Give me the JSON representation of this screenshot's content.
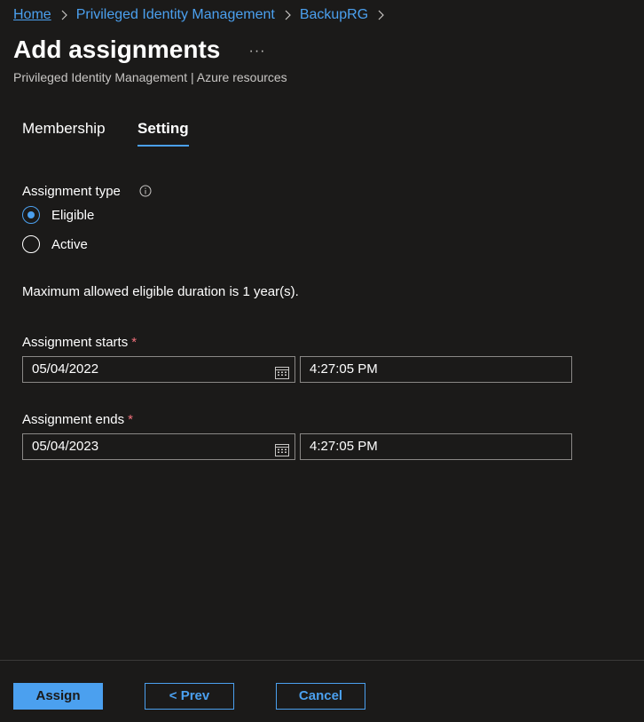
{
  "breadcrumb": {
    "items": [
      "Home",
      "Privileged Identity Management",
      "BackupRG"
    ]
  },
  "header": {
    "title": "Add assignments",
    "more": "···",
    "subtitle": "Privileged Identity Management | Azure resources"
  },
  "tabs": [
    {
      "label": "Membership",
      "selected": false
    },
    {
      "label": "Setting",
      "selected": true
    }
  ],
  "assignment_type": {
    "label": "Assignment type",
    "options": [
      {
        "label": "Eligible",
        "selected": true
      },
      {
        "label": "Active",
        "selected": false
      }
    ]
  },
  "duration_note": "Maximum allowed eligible duration is 1 year(s).",
  "starts": {
    "label": "Assignment starts",
    "required_mark": "*",
    "date": "05/04/2022",
    "time": "4:27:05 PM"
  },
  "ends": {
    "label": "Assignment ends",
    "required_mark": "*",
    "date": "05/04/2023",
    "time": "4:27:05 PM"
  },
  "footer": {
    "assign": "Assign",
    "prev": "< Prev",
    "cancel": "Cancel"
  },
  "colors": {
    "accent": "#4ba0ef",
    "background": "#1b1a19",
    "required": "#f1707b"
  },
  "icons": {
    "breadcrumb_separator": "chevron-right-icon",
    "info": "info-icon",
    "calendar": "calendar-icon"
  }
}
